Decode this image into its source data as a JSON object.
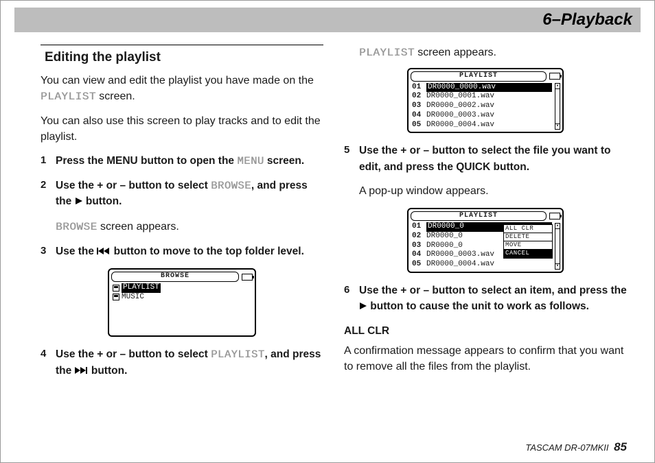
{
  "header": {
    "title": "6–Playback"
  },
  "left": {
    "heading": "Editing the playlist",
    "intro1_a": "You can view and edit the playlist you have made on the ",
    "intro1_term": "PLAYLIST",
    "intro1_b": " screen.",
    "intro2": "You can also use this screen to play tracks and to edit the playlist.",
    "step1_a": "Press the MENU button to open the ",
    "step1_term": "MENU",
    "step1_b": " screen.",
    "step2_a": "Use the + or – button to select ",
    "step2_term": "BROWSE",
    "step2_b": ", and press the ",
    "step2_c": " button.",
    "sub2_term": "BROWSE",
    "sub2_b": " screen appears.",
    "step3_a": "Use the ",
    "step3_b": " button to move to the top folder level.",
    "step4_a": "Use the + or – button to select ",
    "step4_term": "PLAYLIST",
    "step4_b": ", and press the ",
    "step4_c": " button.",
    "lcd_browse": {
      "title": "BROWSE",
      "items": [
        "PLAYLIST",
        "MUSIC"
      ]
    }
  },
  "right": {
    "top_term": "PLAYLIST",
    "top_b": " screen appears.",
    "lcd_playlist1": {
      "title": "PLAYLIST",
      "rows": [
        {
          "idx": "01",
          "name": "DR0000_0000.wav",
          "sel": true
        },
        {
          "idx": "02",
          "name": "DR0000_0001.wav"
        },
        {
          "idx": "03",
          "name": "DR0000_0002.wav"
        },
        {
          "idx": "04",
          "name": "DR0000_0003.wav"
        },
        {
          "idx": "05",
          "name": "DR0000_0004.wav"
        }
      ]
    },
    "step5": "Use the + or – button to select the file you want to edit, and press the QUICK button.",
    "sub5": "A pop-up window appears.",
    "lcd_playlist2": {
      "title": "PLAYLIST",
      "rows": [
        {
          "idx": "01",
          "name": "DR0000_0",
          "sel": true
        },
        {
          "idx": "02",
          "name": "DR0000_0"
        },
        {
          "idx": "03",
          "name": "DR0000_0"
        },
        {
          "idx": "04",
          "name": "DR0000_0003.wav"
        },
        {
          "idx": "05",
          "name": "DR0000_0004.wav"
        }
      ],
      "popup": [
        "ALL CLR",
        "DELETE",
        "MOVE",
        "CANCEL"
      ],
      "popup_sel": 3
    },
    "step6_a": "Use the + or – button to select an item, and press the ",
    "step6_b": " button to cause the unit to work as follows.",
    "allclr_head": "ALL CLR",
    "allclr_body": "A confirmation message appears to confirm that you want to remove all the files from the playlist."
  },
  "footer": {
    "model": "TASCAM DR-07MKII",
    "page": "85"
  }
}
